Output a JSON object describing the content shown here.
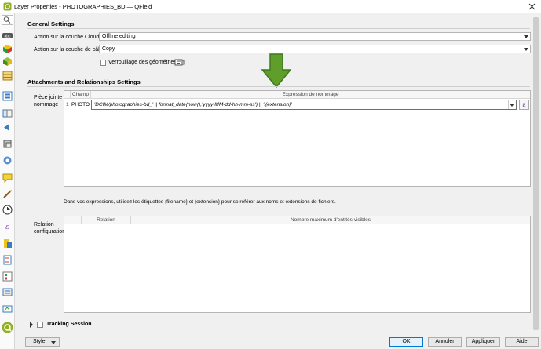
{
  "window": {
    "title": "Layer Properties - PHOTOGRAPHIES_BD — QField"
  },
  "general": {
    "heading": "General Settings",
    "cloud_label": "Action sur la couche Cloud",
    "cloud_value": "Offline editing",
    "cable_label": "Action sur la couche de câble",
    "cable_value": "Copy",
    "lock_label": "Verrouillage des géométries",
    "lock_checked": false
  },
  "attachments": {
    "heading": "Attachments and Relationships Settings",
    "piece_label": "Pièce jointe nommage",
    "columns": [
      "Champ",
      "Expression de nommage"
    ],
    "rows": [
      {
        "num": "1",
        "field": "PHOTO",
        "expression": "'DCIM/photographies-bd_' || format_date(now(),'yyyy-MM-dd-hh-mm-ss') || '.{extension}'"
      }
    ],
    "epsilon": "ε",
    "hint": "Dans vos expressions, utilisez les étiquettes {filename} et {extension} pour se référer aux noms et extensions de fichiers."
  },
  "relations": {
    "label": "Relation configuration",
    "columns": [
      "Relation",
      "Nombre maximum d'entités visibles"
    ]
  },
  "tracking": {
    "label": "Tracking Session",
    "checked": false
  },
  "footer": {
    "style_label": "Style",
    "ok_label": "OK",
    "cancel_label": "Annuler",
    "apply_label": "Appliquer",
    "help_label": "Aide"
  },
  "colors": {
    "arrow_green": "#5f9e2a",
    "arrow_dark": "#3f7a1a",
    "accent": "#0078d7"
  }
}
